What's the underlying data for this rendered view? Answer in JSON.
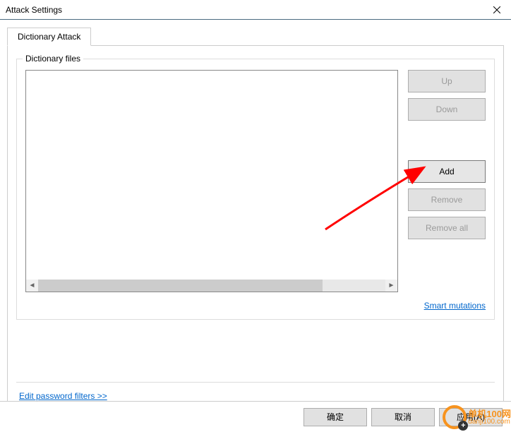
{
  "window": {
    "title": "Attack Settings"
  },
  "tabs": [
    {
      "label": "Dictionary Attack"
    }
  ],
  "group": {
    "label": "Dictionary files"
  },
  "buttons": {
    "up": "Up",
    "down": "Down",
    "add": "Add",
    "remove": "Remove",
    "remove_all": "Remove all"
  },
  "links": {
    "smart_mutations": "Smart mutations",
    "edit_filters": "Edit password filters >>"
  },
  "footer": {
    "ok": "确定",
    "cancel": "取消",
    "apply": "应用(A)"
  },
  "watermark": {
    "line1": "单机100网",
    "line2": "danji100.com"
  }
}
